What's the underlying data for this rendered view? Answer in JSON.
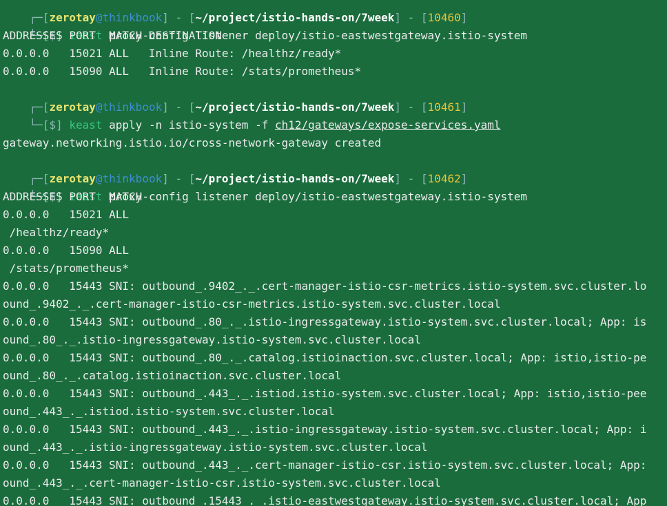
{
  "colors": {
    "background": "#1a6c3d",
    "text": "#ececec",
    "frame": "#8fb8b6",
    "user": "#e8e470",
    "host": "#3e8fd0",
    "path": "#ffffff",
    "history_number": "#e8c53a",
    "command_alias": "#39c47b"
  },
  "prompt": {
    "user": "zerotay",
    "at": "@",
    "host": "thinkbook",
    "path": "~/project/istio-hands-on/7week",
    "dollar": "[$]"
  },
  "lines": {
    "l00_frame": "┌─[",
    "l00_sep": "] - [",
    "l00_histnum": "10460",
    "l00_close": "]",
    "l01_corner": "└─",
    "l01_cmd0": "ieast",
    "l01_rest": " proxy-config listener deploy/istio-eastwestgateway.istio-system",
    "l02": "ADDRESSES PORT  MATCH DESTINATION",
    "l03": "0.0.0.0   15021 ALL   Inline Route: /healthz/ready*",
    "l04": "0.0.0.0   15090 ALL   Inline Route: /stats/prometheus*",
    "l05_histnum": "10461",
    "l06_cmd0": "keast",
    "l06_rest": " apply -n istio-system -f ",
    "l06_file": "ch12/gateways/expose-services.yaml",
    "l08": "gateway.networking.istio.io/cross-network-gateway created",
    "l09_histnum": "10462",
    "l10_cmd0": "ieast",
    "l10_rest": " proxy-config listener deploy/istio-eastwestgateway.istio-system",
    "l11": "ADDRESSES PORT  MATCH",
    "l12": "0.0.0.0   15021 ALL",
    "l13": " /healthz/ready*",
    "l14": "0.0.0.0   15090 ALL",
    "l15": " /stats/prometheus*",
    "l16": "0.0.0.0   15443 SNI: outbound_.9402_._.cert-manager-istio-csr-metrics.istio-system.svc.cluster.lo",
    "l17": "ound_.9402_._.cert-manager-istio-csr-metrics.istio-system.svc.cluster.local",
    "l18": "0.0.0.0   15443 SNI: outbound_.80_._.istio-ingressgateway.istio-system.svc.cluster.local; App: is",
    "l19": "ound_.80_._.istio-ingressgateway.istio-system.svc.cluster.local",
    "l20": "0.0.0.0   15443 SNI: outbound_.80_._.catalog.istioinaction.svc.cluster.local; App: istio,istio-pe",
    "l21": "ound_.80_._.catalog.istioinaction.svc.cluster.local",
    "l22": "0.0.0.0   15443 SNI: outbound_.443_._.istiod.istio-system.svc.cluster.local; App: istio,istio-pee",
    "l23": "ound_.443_._.istiod.istio-system.svc.cluster.local",
    "l24": "0.0.0.0   15443 SNI: outbound_.443_._.istio-ingressgateway.istio-system.svc.cluster.local; App: i",
    "l25": "ound_.443_._.istio-ingressgateway.istio-system.svc.cluster.local",
    "l26": "0.0.0.0   15443 SNI: outbound_.443_._.cert-manager-istio-csr.istio-system.svc.cluster.local; App:",
    "l27": "ound_.443_._.cert-manager-istio-csr.istio-system.svc.cluster.local",
    "l28": "0.0.0.0   15443 SNI: outbound_.15443_._.istio-eastwestgateway.istio-system.svc.cluster.local; App"
  }
}
